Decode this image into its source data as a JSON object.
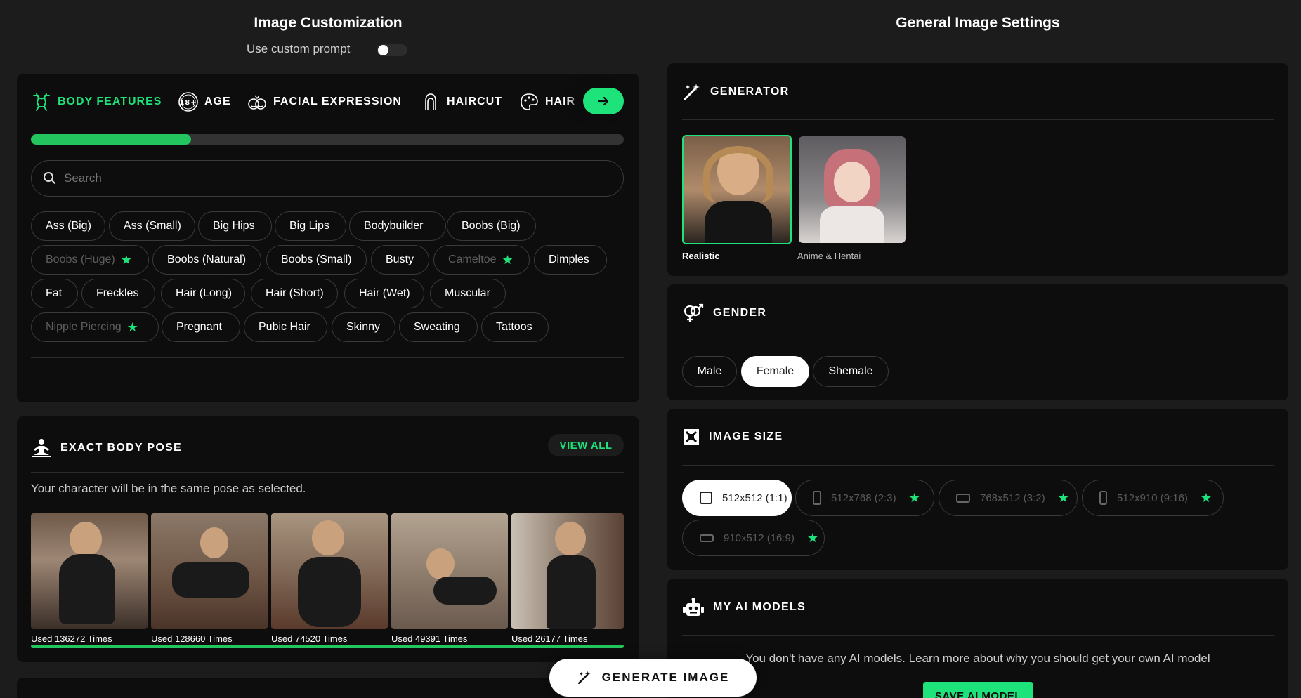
{
  "left": {
    "title": "Image Customization",
    "custom_prompt_label": "Use custom prompt",
    "custom_prompt_on": false
  },
  "right": {
    "title": "General Image Settings"
  },
  "tabs": [
    {
      "label": "BODY FEATURES",
      "icon": "body-icon",
      "active": true
    },
    {
      "label": "AGE",
      "icon": "age-18-icon",
      "active": false
    },
    {
      "label": "FACIAL EXPRESSION",
      "icon": "face-icon",
      "active": false
    },
    {
      "label": "HAIRCUT",
      "icon": "haircut-icon",
      "active": false
    },
    {
      "label": "HAIR",
      "icon": "palette-icon",
      "active": false
    }
  ],
  "progress_fraction": 0.27,
  "search": {
    "placeholder": "Search"
  },
  "tags": [
    {
      "label": "Ass (Big)",
      "locked": false
    },
    {
      "label": "Ass (Small)",
      "locked": false
    },
    {
      "label": "Big Hips",
      "locked": false
    },
    {
      "label": "Big Lips",
      "locked": false
    },
    {
      "label": "Bodybuilder",
      "locked": false
    },
    {
      "label": "Boobs (Big)",
      "locked": false
    },
    {
      "label": "Boobs (Huge)",
      "locked": true
    },
    {
      "label": "Boobs (Natural)",
      "locked": false
    },
    {
      "label": "Boobs (Small)",
      "locked": false
    },
    {
      "label": "Busty",
      "locked": false
    },
    {
      "label": "Cameltoe",
      "locked": true
    },
    {
      "label": "Dimples",
      "locked": false
    },
    {
      "label": "Fat",
      "locked": false
    },
    {
      "label": "Freckles",
      "locked": false
    },
    {
      "label": "Hair (Long)",
      "locked": false
    },
    {
      "label": "Hair (Short)",
      "locked": false
    },
    {
      "label": "Hair (Wet)",
      "locked": false
    },
    {
      "label": "Muscular",
      "locked": false
    },
    {
      "label": "Nipple Piercing",
      "locked": true
    },
    {
      "label": "Pregnant",
      "locked": false
    },
    {
      "label": "Pubic Hair",
      "locked": false
    },
    {
      "label": "Skinny",
      "locked": false
    },
    {
      "label": "Sweating",
      "locked": false
    },
    {
      "label": "Tattoos",
      "locked": false
    }
  ],
  "pose": {
    "title": "EXACT BODY POSE",
    "view_all": "VIEW ALL",
    "description": "Your character will be in the same pose as selected.",
    "items": [
      {
        "used": "Used 136272 Times"
      },
      {
        "used": "Used 128660 Times"
      },
      {
        "used": "Used 74520 Times"
      },
      {
        "used": "Used 49391 Times"
      },
      {
        "used": "Used 26177 Times"
      }
    ]
  },
  "generator": {
    "title": "GENERATOR",
    "options": [
      {
        "label": "Realistic",
        "selected": true
      },
      {
        "label": "Anime & Hentai",
        "selected": false
      }
    ]
  },
  "gender": {
    "title": "GENDER",
    "options": [
      {
        "label": "Male",
        "selected": false
      },
      {
        "label": "Female",
        "selected": true
      },
      {
        "label": "Shemale",
        "selected": false
      }
    ]
  },
  "image_size": {
    "title": "IMAGE SIZE",
    "options": [
      {
        "label": "512x512 (1:1)",
        "selected": true,
        "locked": false
      },
      {
        "label": "512x768 (2:3)",
        "selected": false,
        "locked": true
      },
      {
        "label": "768x512 (3:2)",
        "selected": false,
        "locked": true
      },
      {
        "label": "512x910 (9:16)",
        "selected": false,
        "locked": true
      },
      {
        "label": "910x512 (16:9)",
        "selected": false,
        "locked": true
      }
    ]
  },
  "ai_models": {
    "title": "MY AI MODELS",
    "message": "You don't have any AI models. Learn more about why you should get your own AI model",
    "save_label": "SAVE AI MODEL"
  },
  "generate_label": "GENERATE IMAGE",
  "colors": {
    "accent": "#1ee37a",
    "panel": "#0d0d0d",
    "background": "#1c1c1c"
  }
}
